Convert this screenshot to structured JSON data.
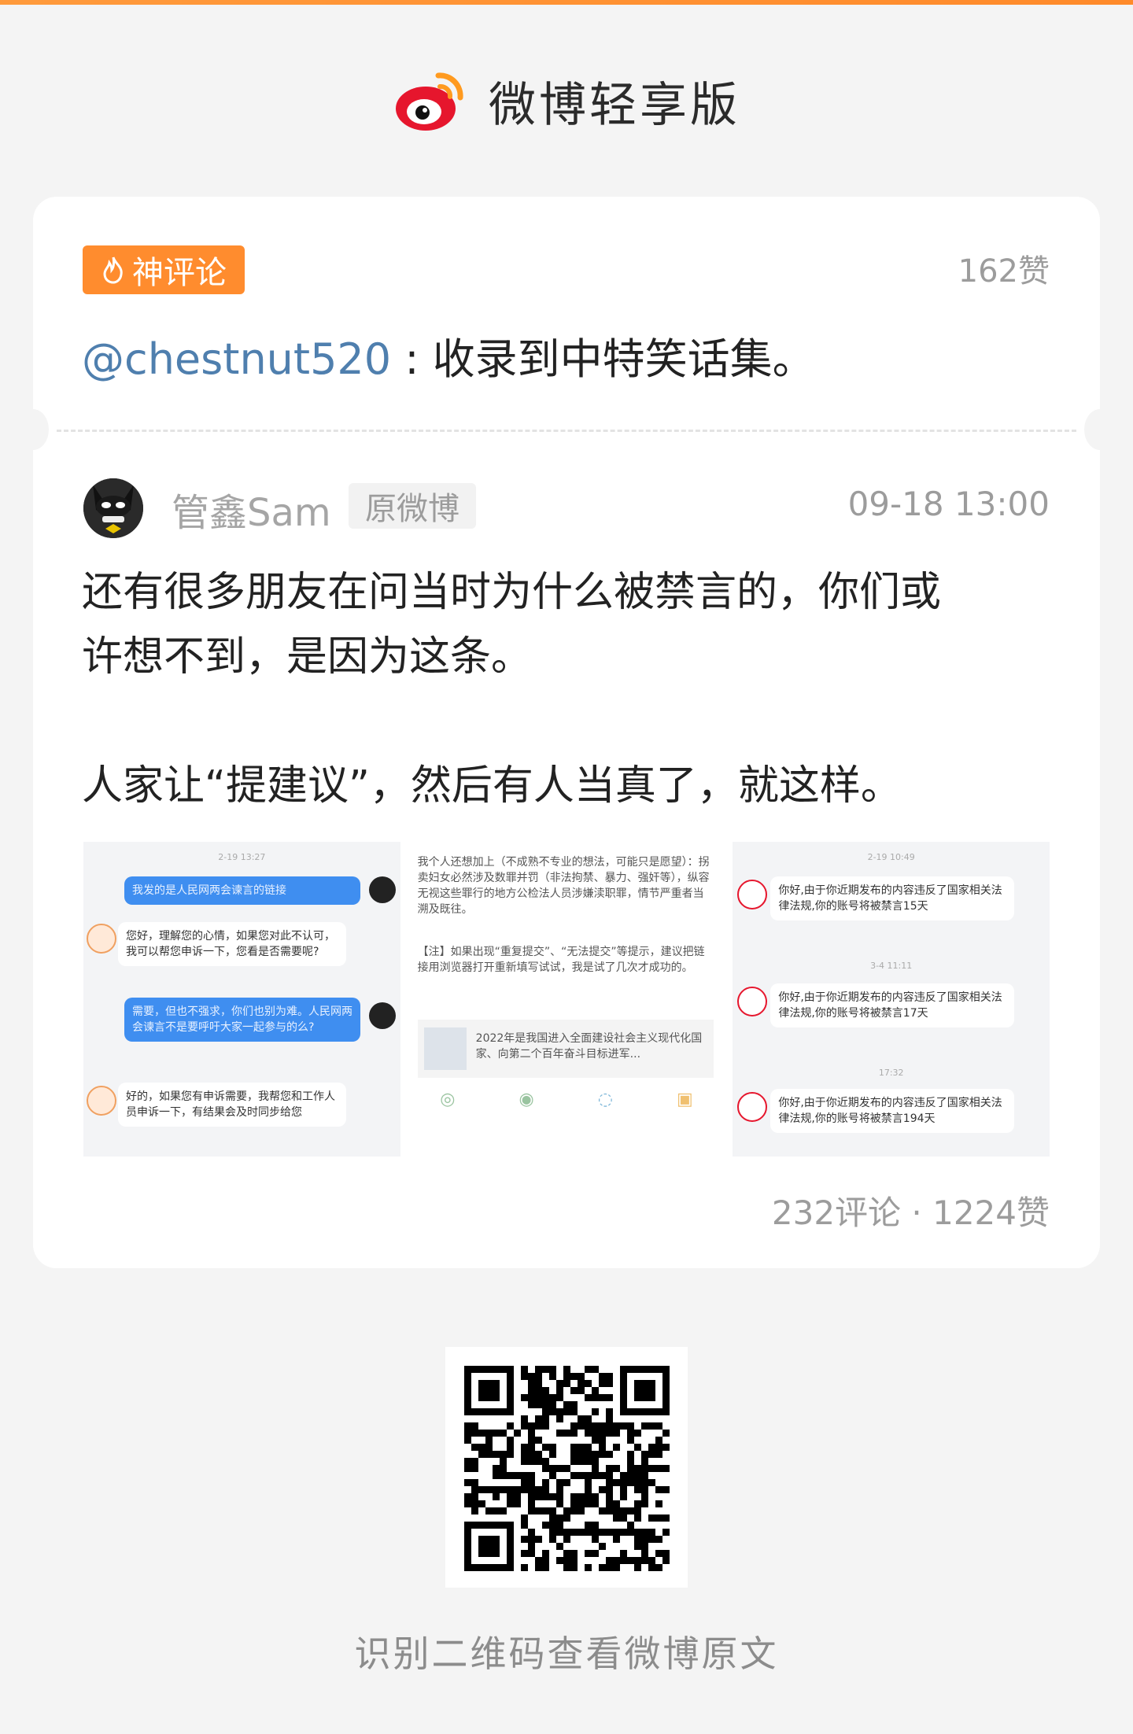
{
  "brand": {
    "title": "微博轻享版",
    "icon": "weibo-logo-icon"
  },
  "hot_comment": {
    "tag_label": "神评论",
    "tag_icon": "flame-icon",
    "likes": "162赞",
    "user": "@chestnut520",
    "separator": ":",
    "text": "收录到中特笑话集。"
  },
  "original_post": {
    "author": "管鑫Sam",
    "badge": "原微博",
    "time": "09-18 13:00",
    "lines": [
      "还有很多朋友在问当时为什么被禁言的，你们或",
      "许想不到，是因为这条。",
      "人家让“提建议”，然后有人当真了，就这样。"
    ],
    "images": [
      {
        "time": "2-19 13:27",
        "messages": [
          "我发的是人民网两会谏言的链接",
          "您好，理解您的心情，如果您对此不认可，我可以帮您申诉一下，您看是否需要呢?",
          "需要，但也不强求，你们也别为难。人民网两会谏言不是要呼吁大家一起参与的么?",
          "好的，如果您有申诉需要，我帮您和工作人员申诉一下，有结果会及时同步给您"
        ]
      },
      {
        "paragraph1": "我个人还想加上（不成熟不专业的想法，可能只是愿望）：拐卖妇女必然涉及数罪并罚（非法拘禁、暴力、强奸等），纵容无视这些罪行的地方公检法人员涉嫌渎职罪，情节严重者当溯及既往。",
        "paragraph2": "【注】如果出现“重复提交”、“无法提交”等提示，建议把链接用浏览器打开重新填写试试，我是试了几次才成功的。",
        "link_title": "2022年是我国进入全面建设社会主义现代化国家、向第二个百年奋斗目标进军..."
      },
      {
        "items": [
          {
            "time": "2-19 10:49",
            "text": "你好,由于你近期发布的内容违反了国家相关法律法规,你的账号将被禁言15天"
          },
          {
            "time": "3-4 11:11",
            "text": "你好,由于你近期发布的内容违反了国家相关法律法规,你的账号将被禁言17天"
          },
          {
            "time": "17:32",
            "text": "你好,由于你近期发布的内容违反了国家相关法律法规,你的账号将被禁言194天"
          }
        ]
      }
    ],
    "stats": "232评论 · 1224赞"
  },
  "qr_caption": "识别二维码查看微博原文",
  "colors": {
    "accent": "#ff8c2e",
    "link": "#4f7fae",
    "background": "#f4f4f4"
  }
}
